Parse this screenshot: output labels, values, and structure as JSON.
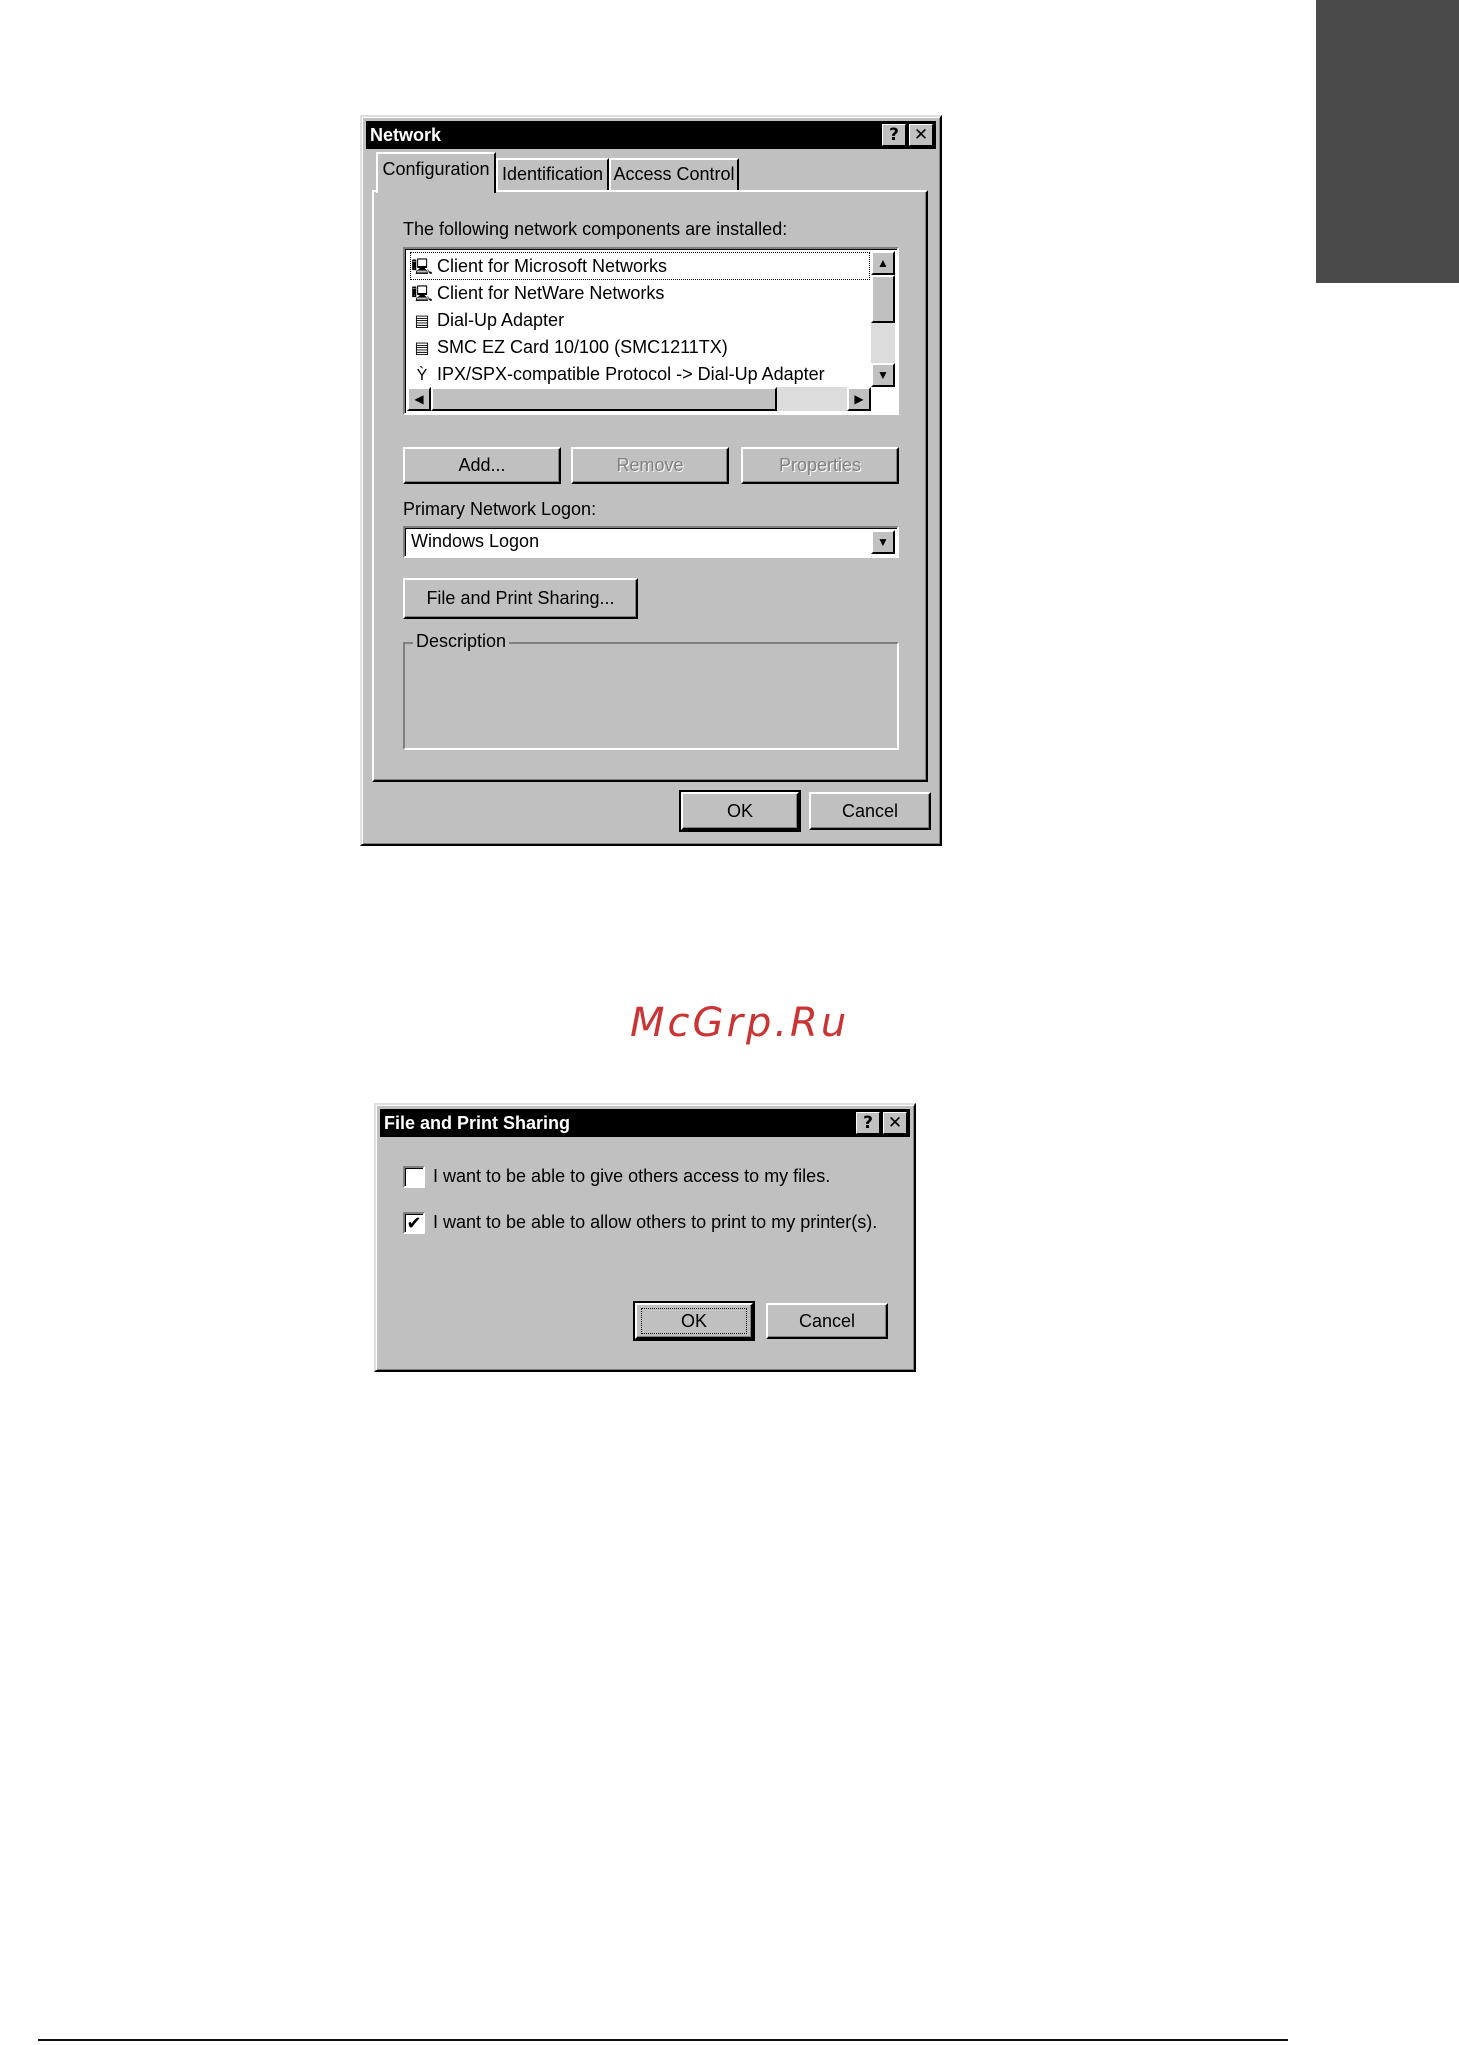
{
  "network_dialog": {
    "title": "Network",
    "help_glyph": "?",
    "close_glyph": "✕",
    "tabs": [
      {
        "label": "Configuration"
      },
      {
        "label": "Identification"
      },
      {
        "label": "Access Control"
      }
    ],
    "components_label": "The following network components are installed:",
    "components": [
      {
        "label": "Client for Microsoft Networks",
        "icon": "client-icon"
      },
      {
        "label": "Client for NetWare Networks",
        "icon": "client-icon"
      },
      {
        "label": "Dial-Up Adapter",
        "icon": "adapter-icon"
      },
      {
        "label": "SMC EZ Card 10/100 (SMC1211TX)",
        "icon": "adapter-icon"
      },
      {
        "label": "IPX/SPX-compatible Protocol -> Dial-Up Adapter",
        "icon": "protocol-icon"
      }
    ],
    "add_button": "Add...",
    "remove_button": "Remove",
    "properties_button": "Properties",
    "logon_label": "Primary Network Logon:",
    "logon_value": "Windows Logon",
    "sharing_button": "File and Print Sharing...",
    "description_label": "Description",
    "ok_button": "OK",
    "cancel_button": "Cancel"
  },
  "sharing_dialog": {
    "title": "File and Print Sharing",
    "help_glyph": "?",
    "close_glyph": "✕",
    "files_option": {
      "label": "I want to be able to give others access to my files.",
      "checked": false
    },
    "printer_option": {
      "label": "I want to be able to allow others to print to my printer(s).",
      "checked": true
    },
    "check_glyph": "✔",
    "ok_button": "OK",
    "cancel_button": "Cancel"
  },
  "watermark": "McGrp.Ru",
  "colors": {
    "titlebar": "#000000",
    "face": "#c0c0c0",
    "watermark": "#cc3333",
    "side_tab": "#4a4a4a"
  }
}
